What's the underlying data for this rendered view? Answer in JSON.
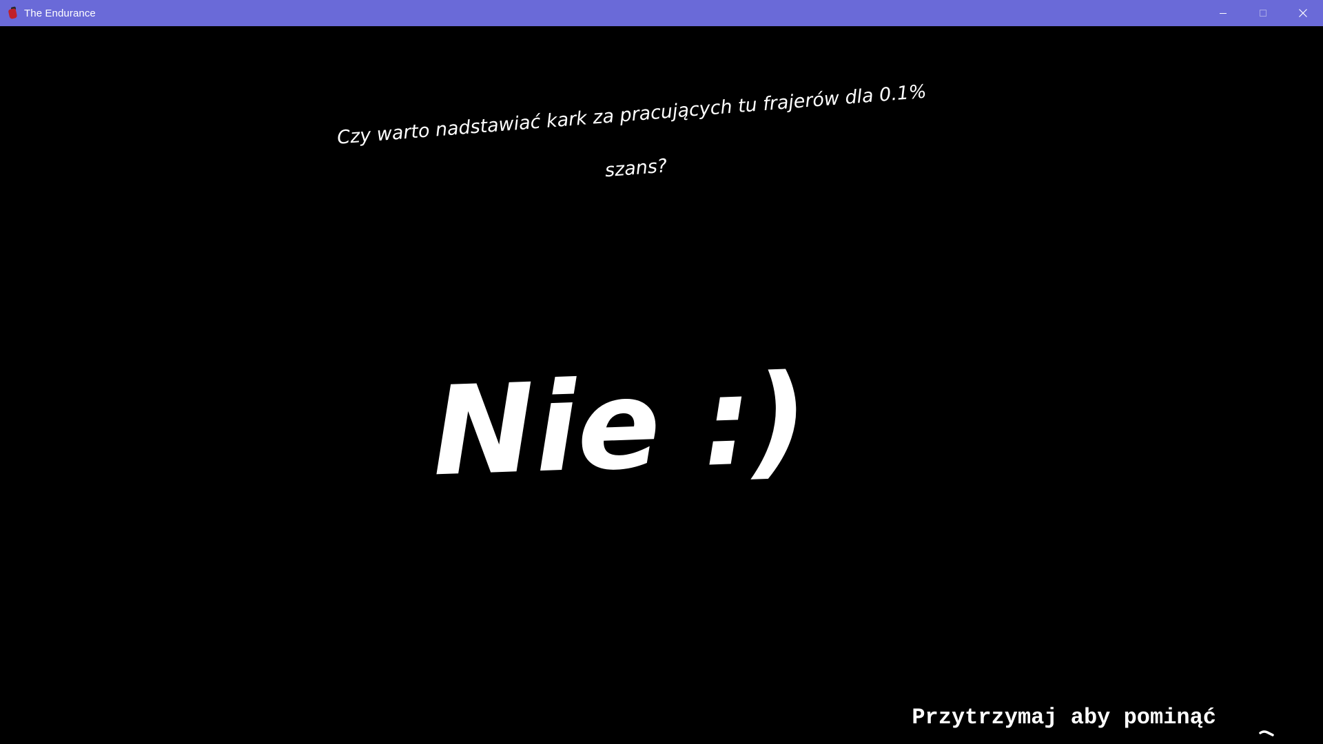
{
  "window": {
    "title": "The Endurance",
    "app_icon": "fire-extinguisher-icon",
    "controls": [
      "minimize-icon",
      "maximize-icon",
      "close-icon"
    ]
  },
  "scene": {
    "question": "Czy warto nadstawiać kark za pracujących tu frajerów dla 0.1% szans?",
    "answer": "Nie :)",
    "skip_hint": "Przytrzymaj aby pominąć",
    "skip_progress_icon": "hold-progress-ring-icon"
  },
  "colors": {
    "titlebar": "#6a6ad8",
    "background": "#000000",
    "text": "#ffffff"
  }
}
